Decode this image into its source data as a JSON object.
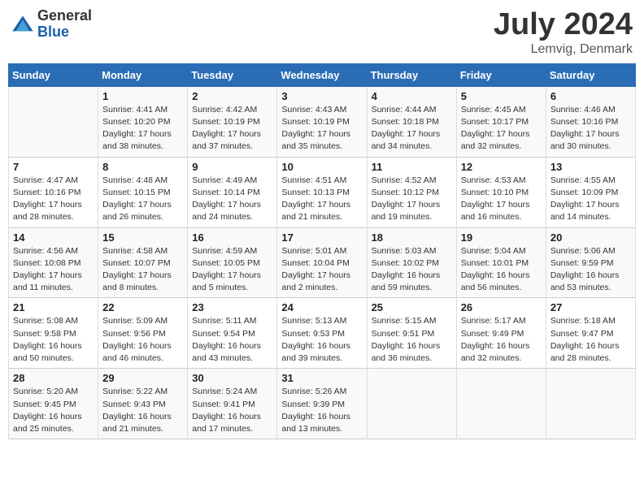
{
  "logo": {
    "general": "General",
    "blue": "Blue"
  },
  "title": "July 2024",
  "subtitle": "Lemvig, Denmark",
  "days_of_week": [
    "Sunday",
    "Monday",
    "Tuesday",
    "Wednesday",
    "Thursday",
    "Friday",
    "Saturday"
  ],
  "weeks": [
    [
      {
        "day": "",
        "info": ""
      },
      {
        "day": "1",
        "info": "Sunrise: 4:41 AM\nSunset: 10:20 PM\nDaylight: 17 hours and 38 minutes."
      },
      {
        "day": "2",
        "info": "Sunrise: 4:42 AM\nSunset: 10:19 PM\nDaylight: 17 hours and 37 minutes."
      },
      {
        "day": "3",
        "info": "Sunrise: 4:43 AM\nSunset: 10:19 PM\nDaylight: 17 hours and 35 minutes."
      },
      {
        "day": "4",
        "info": "Sunrise: 4:44 AM\nSunset: 10:18 PM\nDaylight: 17 hours and 34 minutes."
      },
      {
        "day": "5",
        "info": "Sunrise: 4:45 AM\nSunset: 10:17 PM\nDaylight: 17 hours and 32 minutes."
      },
      {
        "day": "6",
        "info": "Sunrise: 4:46 AM\nSunset: 10:16 PM\nDaylight: 17 hours and 30 minutes."
      }
    ],
    [
      {
        "day": "7",
        "info": "Sunrise: 4:47 AM\nSunset: 10:16 PM\nDaylight: 17 hours and 28 minutes."
      },
      {
        "day": "8",
        "info": "Sunrise: 4:48 AM\nSunset: 10:15 PM\nDaylight: 17 hours and 26 minutes."
      },
      {
        "day": "9",
        "info": "Sunrise: 4:49 AM\nSunset: 10:14 PM\nDaylight: 17 hours and 24 minutes."
      },
      {
        "day": "10",
        "info": "Sunrise: 4:51 AM\nSunset: 10:13 PM\nDaylight: 17 hours and 21 minutes."
      },
      {
        "day": "11",
        "info": "Sunrise: 4:52 AM\nSunset: 10:12 PM\nDaylight: 17 hours and 19 minutes."
      },
      {
        "day": "12",
        "info": "Sunrise: 4:53 AM\nSunset: 10:10 PM\nDaylight: 17 hours and 16 minutes."
      },
      {
        "day": "13",
        "info": "Sunrise: 4:55 AM\nSunset: 10:09 PM\nDaylight: 17 hours and 14 minutes."
      }
    ],
    [
      {
        "day": "14",
        "info": "Sunrise: 4:56 AM\nSunset: 10:08 PM\nDaylight: 17 hours and 11 minutes."
      },
      {
        "day": "15",
        "info": "Sunrise: 4:58 AM\nSunset: 10:07 PM\nDaylight: 17 hours and 8 minutes."
      },
      {
        "day": "16",
        "info": "Sunrise: 4:59 AM\nSunset: 10:05 PM\nDaylight: 17 hours and 5 minutes."
      },
      {
        "day": "17",
        "info": "Sunrise: 5:01 AM\nSunset: 10:04 PM\nDaylight: 17 hours and 2 minutes."
      },
      {
        "day": "18",
        "info": "Sunrise: 5:03 AM\nSunset: 10:02 PM\nDaylight: 16 hours and 59 minutes."
      },
      {
        "day": "19",
        "info": "Sunrise: 5:04 AM\nSunset: 10:01 PM\nDaylight: 16 hours and 56 minutes."
      },
      {
        "day": "20",
        "info": "Sunrise: 5:06 AM\nSunset: 9:59 PM\nDaylight: 16 hours and 53 minutes."
      }
    ],
    [
      {
        "day": "21",
        "info": "Sunrise: 5:08 AM\nSunset: 9:58 PM\nDaylight: 16 hours and 50 minutes."
      },
      {
        "day": "22",
        "info": "Sunrise: 5:09 AM\nSunset: 9:56 PM\nDaylight: 16 hours and 46 minutes."
      },
      {
        "day": "23",
        "info": "Sunrise: 5:11 AM\nSunset: 9:54 PM\nDaylight: 16 hours and 43 minutes."
      },
      {
        "day": "24",
        "info": "Sunrise: 5:13 AM\nSunset: 9:53 PM\nDaylight: 16 hours and 39 minutes."
      },
      {
        "day": "25",
        "info": "Sunrise: 5:15 AM\nSunset: 9:51 PM\nDaylight: 16 hours and 36 minutes."
      },
      {
        "day": "26",
        "info": "Sunrise: 5:17 AM\nSunset: 9:49 PM\nDaylight: 16 hours and 32 minutes."
      },
      {
        "day": "27",
        "info": "Sunrise: 5:18 AM\nSunset: 9:47 PM\nDaylight: 16 hours and 28 minutes."
      }
    ],
    [
      {
        "day": "28",
        "info": "Sunrise: 5:20 AM\nSunset: 9:45 PM\nDaylight: 16 hours and 25 minutes."
      },
      {
        "day": "29",
        "info": "Sunrise: 5:22 AM\nSunset: 9:43 PM\nDaylight: 16 hours and 21 minutes."
      },
      {
        "day": "30",
        "info": "Sunrise: 5:24 AM\nSunset: 9:41 PM\nDaylight: 16 hours and 17 minutes."
      },
      {
        "day": "31",
        "info": "Sunrise: 5:26 AM\nSunset: 9:39 PM\nDaylight: 16 hours and 13 minutes."
      },
      {
        "day": "",
        "info": ""
      },
      {
        "day": "",
        "info": ""
      },
      {
        "day": "",
        "info": ""
      }
    ]
  ]
}
